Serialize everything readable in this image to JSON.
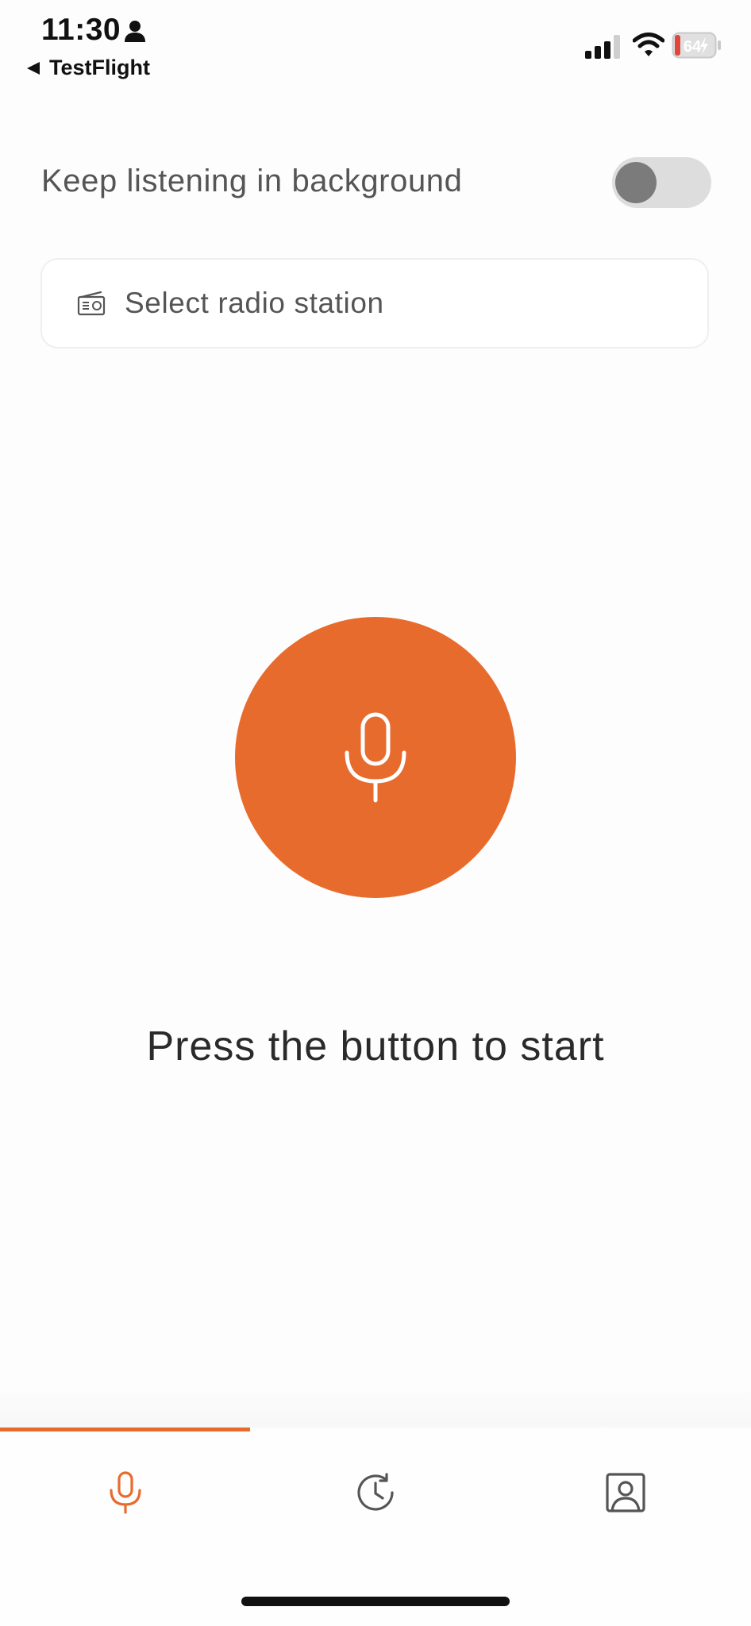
{
  "status_bar": {
    "time": "11:30",
    "back_label": "TestFlight",
    "battery_level": "64"
  },
  "settings": {
    "background_listening_label": "Keep listening in background",
    "background_listening_enabled": false
  },
  "station_selector": {
    "label": "Select radio station",
    "icon": "radio-icon"
  },
  "main": {
    "mic_button_icon": "microphone-icon",
    "prompt": "Press the button to start"
  },
  "bottom_nav": {
    "items": [
      {
        "icon": "microphone-icon",
        "active": true
      },
      {
        "icon": "history-icon",
        "active": false
      },
      {
        "icon": "profile-icon",
        "active": false
      }
    ]
  },
  "colors": {
    "accent": "#e86b2e",
    "toggle_track": "#dddddd",
    "toggle_knob": "#7b7b7b",
    "text_secondary": "#555555",
    "text_primary": "#2a2a2a"
  }
}
